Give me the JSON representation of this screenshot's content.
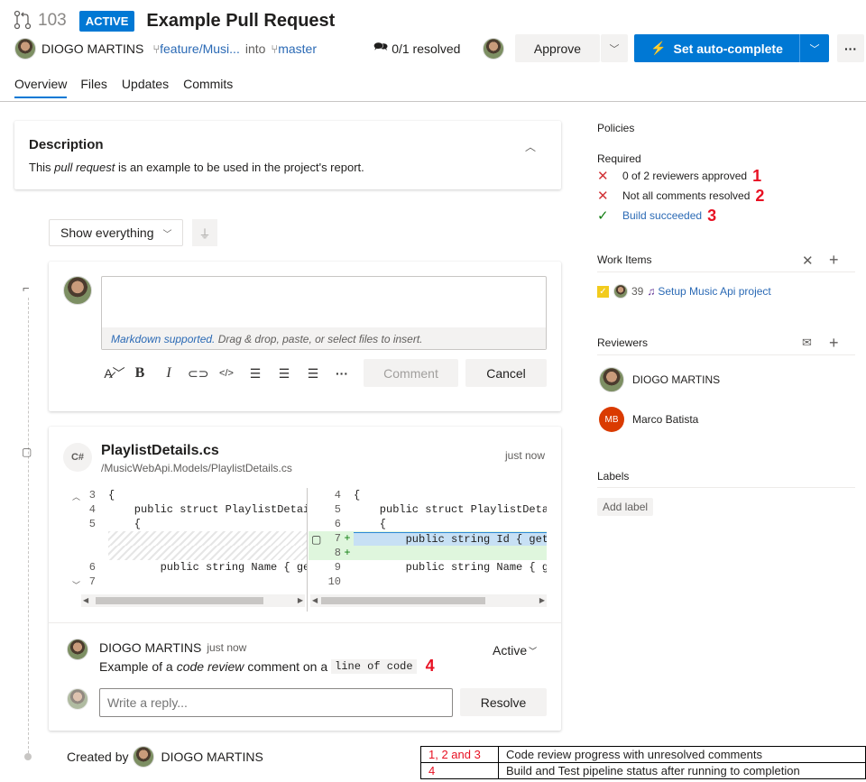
{
  "header": {
    "pr_number": "103",
    "status_badge": "ACTIVE",
    "title": "Example Pull Request",
    "author": "DIOGO MARTINS",
    "source_branch": "feature/Musi...",
    "into": "into",
    "target_branch": "master",
    "resolved": "0/1 resolved",
    "approve_label": "Approve",
    "autocomplete_label": "Set auto-complete",
    "more_label": "···"
  },
  "tabs": [
    "Overview",
    "Files",
    "Updates",
    "Commits"
  ],
  "description": {
    "heading": "Description",
    "text_pre": "This ",
    "text_em": "pull request",
    "text_post": " is an example to be used in the project's report."
  },
  "filter": {
    "dropdown": "Show everything"
  },
  "comment_box": {
    "hint_link": "Markdown supported.",
    "hint_text": " Drag & drop, paste, or select files to insert.",
    "comment_label": "Comment",
    "cancel_label": "Cancel"
  },
  "file_thread": {
    "lang": "C#",
    "filename": "PlaylistDetails.cs",
    "path": "/MusicWebApi.Models/PlaylistDetails.cs",
    "time": "just now",
    "left_lines": [
      {
        "num": "3",
        "code": "{"
      },
      {
        "num": "4",
        "code": "    public struct PlaylistDetail"
      },
      {
        "num": "5",
        "code": "    {"
      },
      {
        "num": "",
        "code": ""
      },
      {
        "num": "",
        "code": ""
      },
      {
        "num": "6",
        "code": "        public string Name { get"
      },
      {
        "num": "7",
        "code": ""
      }
    ],
    "right_lines": [
      {
        "num": "4",
        "mark": "",
        "code": "{"
      },
      {
        "num": "5",
        "mark": "",
        "code": "    public struct PlaylistDetai"
      },
      {
        "num": "6",
        "mark": "",
        "code": "    {"
      },
      {
        "num": "7",
        "mark": "+",
        "code": "        public string Id { get;"
      },
      {
        "num": "8",
        "mark": "+",
        "code": ""
      },
      {
        "num": "9",
        "mark": "",
        "code": "        public string Name { ge"
      },
      {
        "num": "10",
        "mark": "",
        "code": ""
      }
    ],
    "comment_author": "DIOGO MARTINS",
    "comment_time": "just now",
    "comment_status": "Active",
    "comment_pre": "Example of a ",
    "comment_em": "code review",
    "comment_mid": " comment on a ",
    "comment_code": "line of code",
    "annotation": "4",
    "reply_placeholder": "Write a reply...",
    "resolve_label": "Resolve"
  },
  "created_by": {
    "label": "Created by",
    "name": "DIOGO MARTINS"
  },
  "policies": {
    "heading": "Policies",
    "required": "Required",
    "items": [
      {
        "text": "0 of 2 reviewers approved",
        "num": "1",
        "ok": false
      },
      {
        "text": "Not all comments resolved",
        "num": "2",
        "ok": false
      },
      {
        "text": "Build succeeded",
        "num": "3",
        "ok": true
      }
    ]
  },
  "work_items": {
    "heading": "Work Items",
    "item_id": "39",
    "item_title": "Setup Music Api project"
  },
  "reviewers": {
    "heading": "Reviewers",
    "list": [
      {
        "name": "DIOGO MARTINS",
        "initials": ""
      },
      {
        "name": "Marco Batista",
        "initials": "MB"
      }
    ]
  },
  "labels": {
    "heading": "Labels",
    "add_label": "Add label"
  },
  "legend": [
    {
      "key": "1, 2 and 3",
      "desc": "Code review progress with unresolved comments"
    },
    {
      "key": "4",
      "desc": "Build and Test pipeline status after running to completion"
    }
  ],
  "colors": {
    "accent": "#0078d4",
    "badge": "#0078d4",
    "annotation": "#e81123"
  }
}
